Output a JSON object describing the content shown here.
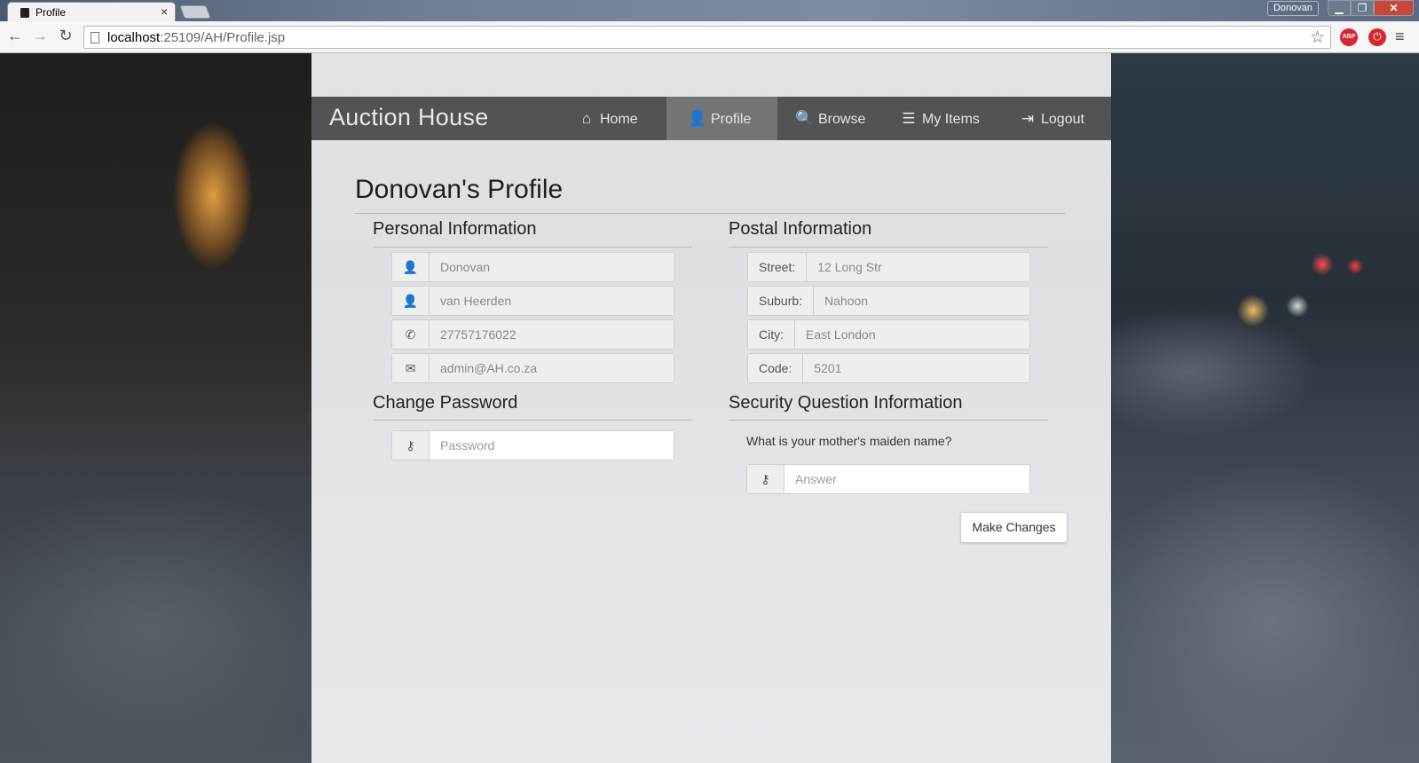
{
  "browser": {
    "tab_title": "Profile",
    "tab_close": "×",
    "profile_user": "Donovan",
    "window_buttons": {
      "minimize": "▁",
      "maximize": "❐",
      "close": "✕"
    },
    "url_host": "localhost",
    "url_path": ":25109/AH/Profile.jsp",
    "extension_abp": "ABP",
    "nav": {
      "back": "←",
      "forward": "→",
      "reload": "↻",
      "star": "☆",
      "menu": "≡",
      "power": "⏻"
    }
  },
  "navbar": {
    "brand": "Auction House",
    "items": [
      {
        "label": "Home",
        "icon": "home-icon",
        "glyph": "⌂"
      },
      {
        "label": "Profile",
        "icon": "user-icon",
        "glyph": "👤",
        "active": true
      },
      {
        "label": "Browse",
        "icon": "search-icon",
        "glyph": "🔍"
      },
      {
        "label": "My Items",
        "icon": "list-icon",
        "glyph": "☰"
      },
      {
        "label": "Logout",
        "icon": "logout-icon",
        "glyph": "⇥"
      }
    ]
  },
  "page": {
    "title": "Donovan's Profile"
  },
  "personal": {
    "heading": "Personal Information",
    "first_name": "Donovan",
    "last_name": "van Heerden",
    "phone": "27757176022",
    "email": "admin@AH.co.za"
  },
  "postal": {
    "heading": "Postal Information",
    "street_label": "Street:",
    "street": "12 Long Str",
    "suburb_label": "Suburb:",
    "suburb": "Nahoon",
    "city_label": "City:",
    "city": "East London",
    "code_label": "Code:",
    "code": "5201"
  },
  "password": {
    "heading": "Change Password",
    "placeholder": "Password"
  },
  "security": {
    "heading": "Security Question Information",
    "question": "What is your mother's maiden name?",
    "answer_placeholder": "Answer"
  },
  "actions": {
    "submit": "Make Changes"
  },
  "icons": {
    "user": "👤",
    "phone": "✆",
    "envelope": "✉",
    "key": "⚷"
  }
}
